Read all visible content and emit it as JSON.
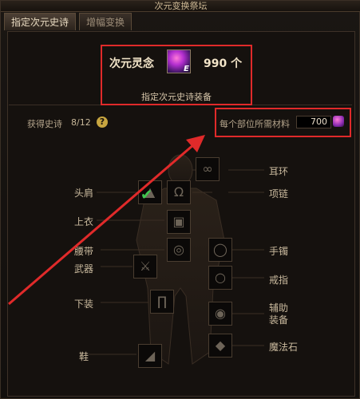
{
  "window": {
    "title": "次元变换祭坛"
  },
  "tabs": [
    {
      "label": "指定次元史诗",
      "active": true
    },
    {
      "label": "增幅变换",
      "active": false
    }
  ],
  "currency": {
    "label": "次元灵念",
    "icon": "dimension-soul-icon",
    "icon_badge": "E",
    "count": "990 个",
    "subtitle": "指定次元史诗装备"
  },
  "progress": {
    "label": "获得史诗",
    "value": "8/12",
    "help_glyph": "?"
  },
  "material": {
    "label": "每个部位所需材料",
    "value": "700",
    "icon": "dimension-soul-small-icon"
  },
  "slots": {
    "shoulder": {
      "label": "头肩",
      "checked": true,
      "icon": "shoulder-icon"
    },
    "top": {
      "label": "上衣",
      "icon": "top-icon"
    },
    "belt": {
      "label": "腰带",
      "icon": "belt-icon"
    },
    "weapon": {
      "label": "武器",
      "icon": "weapon-icon"
    },
    "pants": {
      "label": "下装",
      "icon": "pants-icon"
    },
    "shoes": {
      "label": "鞋",
      "icon": "shoes-icon"
    },
    "earring": {
      "label": "耳环",
      "icon": "earring-icon"
    },
    "necklace": {
      "label": "项链",
      "icon": "necklace-icon"
    },
    "bracelet": {
      "label": "手镯",
      "icon": "bracelet-icon"
    },
    "ring": {
      "label": "戒指",
      "icon": "ring-icon"
    },
    "support": {
      "label": "辅助\n装备",
      "icon": "support-equipment-icon"
    },
    "magic_stone": {
      "label": "魔法石",
      "icon": "magic-stone-icon"
    }
  },
  "annotation_colors": {
    "highlight": "#e02a2a",
    "check": "#40c850"
  }
}
